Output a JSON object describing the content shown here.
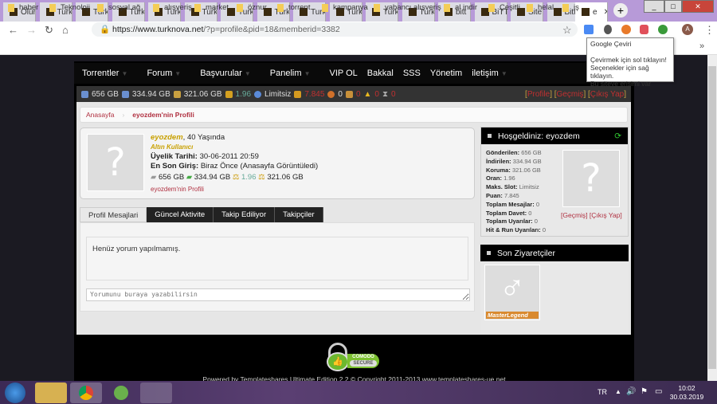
{
  "browser": {
    "tabs": [
      "Ölür",
      "Turk",
      "Turk",
      "Turk",
      "Turk",
      "Turk",
      "Turk",
      "Turk",
      "Turk",
      "Turk",
      "Turk",
      "Turk",
      "bitt",
      "BiTT",
      "Site",
      "Bitt",
      "e"
    ],
    "url_host": "https://www.turknova.net",
    "url_path": "/?p=profile&pid=18&memberid=3382",
    "bookmarks": [
      "haber",
      "Teknoloji",
      "sosyal ağ",
      "alışveriş",
      "market",
      "öznur",
      "torrent",
      "kampanya",
      "yabancı alışveriş",
      "al indir",
      "Çeşitli",
      "helal",
      "iş"
    ],
    "tooltip": {
      "title": "Google Çeviri",
      "lines": [
        "Çevirmek için sol tıklayın!",
        "Seçenekler için sağ tıklayın.",
        "Bu siteye erişimi var"
      ]
    }
  },
  "nav": [
    "Torrentler",
    "Forum",
    "Başvurular",
    "Panelim",
    "VIP OL",
    "Bakkal",
    "SSS",
    "Yönetim",
    "iletişim"
  ],
  "stats": {
    "uploaded": "656 GB",
    "downloaded": "334.94 GB",
    "buffer": "321.06 GB",
    "ratio": "1.96",
    "slots": "Limitsiz",
    "points": "7.845",
    "messages": "0",
    "invites": "0",
    "warnings": "0",
    "hnr": "0",
    "links": [
      "Profile",
      "Geçmiş",
      "Çıkış Yap"
    ]
  },
  "breadcrumb": [
    "Anasayfa",
    "eyozdem'nin Profili"
  ],
  "profile": {
    "username": "eyozdem",
    "age": "40 Yaşında",
    "rank": "Altın Kullanıcı",
    "joined_label": "Üyelik Tarihi:",
    "joined": "30-06-2011 20:59",
    "last_label": "En Son Giriş:",
    "last": "Biraz Önce (Anasayfa Görüntüledi)",
    "up": "656 GB",
    "down": "334.94 GB",
    "ratio": "1.96",
    "buffer": "321.06 GB",
    "link": "eyozdem'nin Profili"
  },
  "tabs": [
    "Profil Mesajlari",
    "Güncel Aktivite",
    "Takip Ediliyor",
    "Takipçiler"
  ],
  "messages": {
    "empty": "Henüz yorum yapılmamış.",
    "placeholder": "Yorumunu buraya yazabilirsin"
  },
  "welcome": {
    "title": "Hoşgeldiniz: eyozdem",
    "rows": [
      [
        "Gönderilen:",
        "656 GB"
      ],
      [
        "İndirilen:",
        "334.94 GB"
      ],
      [
        "Koruma:",
        "321.06 GB"
      ],
      [
        "Oran:",
        "1.96"
      ],
      [
        "Maks. Slot:",
        "Limitsiz"
      ],
      [
        "Puan:",
        "7.845"
      ],
      [
        "Toplam Mesajlar:",
        "0"
      ],
      [
        "Toplam Davet:",
        "0"
      ],
      [
        "Toplam Uyarılar:",
        "0"
      ],
      [
        "Hit & Run Uyarıları:",
        "0"
      ]
    ],
    "history": "Geçmiş",
    "logout": "Çıkış Yap"
  },
  "visitors": {
    "title": "Son Ziyaretçiler",
    "badge": "MasterLegend"
  },
  "footer": {
    "badge_top": "COMODO",
    "badge_bottom": "SECURE",
    "copyright": "Powered by Templateshares Ultimate Edition 2.2 © Copyright 2011-2013 www.templateshares-ue.net"
  },
  "taskbar": {
    "lang": "TR",
    "time": "10:02",
    "date": "30.03.2019"
  }
}
